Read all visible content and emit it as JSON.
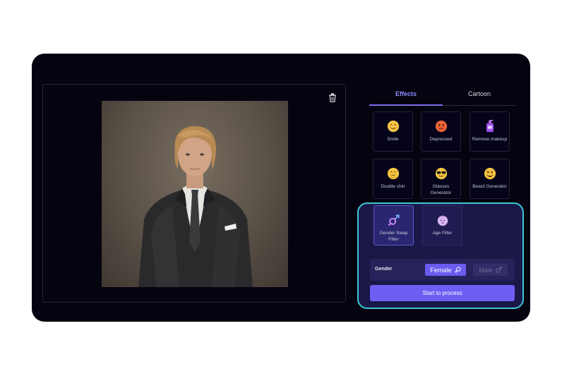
{
  "canvas": {
    "delete_icon": "trash-icon",
    "photo_description": "portrait-photo"
  },
  "sidebar": {
    "tabs": [
      {
        "label": "Effects",
        "active": true
      },
      {
        "label": "Cartoon",
        "active": false
      }
    ],
    "effects": [
      {
        "label": "Smile",
        "icon": "smile-emoji-icon"
      },
      {
        "label": "Depressed",
        "icon": "angry-emoji-icon"
      },
      {
        "label": "Remove makeup",
        "icon": "makeup-bottle-icon"
      },
      {
        "label": "Double chin",
        "icon": "double-chin-emoji-icon"
      },
      {
        "label": "Glasses Generator",
        "icon": "sunglasses-emoji-icon"
      },
      {
        "label": "Beard Generator",
        "icon": "beard-emoji-icon"
      },
      {
        "label": "Gender Swap Filter",
        "icon": "gender-swap-icon",
        "selected": true
      },
      {
        "label": "Age Filter",
        "icon": "baby-face-icon"
      }
    ],
    "gender": {
      "label": "Gender",
      "options": [
        {
          "label": "Female",
          "icon": "female-symbol-icon",
          "selected": true
        },
        {
          "label": "Male",
          "icon": "male-symbol-icon",
          "selected": false
        }
      ]
    },
    "process_button": "Start to process"
  },
  "colors": {
    "app_bg": "#04030f",
    "accent": "#6d5ff3",
    "highlight_border": "#3ec8d8"
  }
}
